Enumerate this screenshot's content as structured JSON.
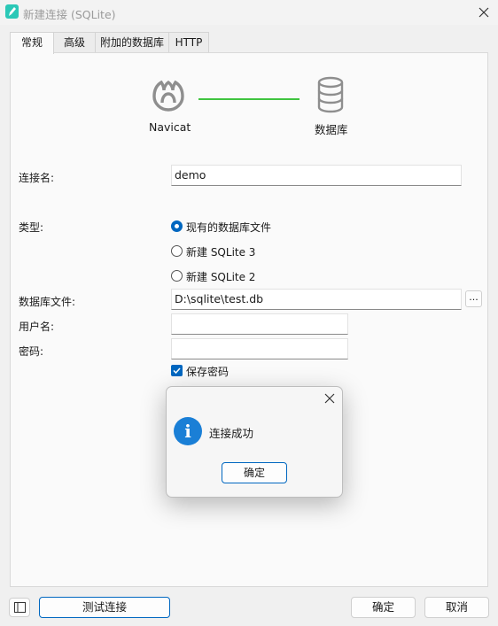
{
  "window": {
    "title": "新建连接 (SQLite)"
  },
  "tabs": [
    {
      "label": "常规",
      "active": true
    },
    {
      "label": "高级",
      "active": false
    },
    {
      "label": "附加的数据库",
      "active": false
    },
    {
      "label": "HTTP",
      "active": false
    }
  ],
  "header_graphic": {
    "left_label": "Navicat",
    "right_label": "数据库",
    "connector_color": "#3fc43f"
  },
  "form": {
    "connection_name": {
      "label": "连接名:",
      "value": "demo"
    },
    "type": {
      "label": "类型:",
      "options": [
        {
          "label": "现有的数据库文件",
          "selected": true
        },
        {
          "label": "新建 SQLite 3",
          "selected": false
        },
        {
          "label": "新建 SQLite 2",
          "selected": false
        }
      ]
    },
    "db_file": {
      "label": "数据库文件:",
      "value": "D:\\sqlite\\test.db",
      "browse_label": "..."
    },
    "username": {
      "label": "用户名:",
      "value": ""
    },
    "password": {
      "label": "密码:",
      "value": ""
    },
    "save_password": {
      "label": "保存密码",
      "checked": true
    }
  },
  "message_box": {
    "text": "连接成功",
    "ok_label": "确定",
    "icon": "info-icon"
  },
  "footer": {
    "test_label": "测试连接",
    "ok_label": "确定",
    "cancel_label": "取消"
  },
  "colors": {
    "accent": "#0067c0",
    "info": "#1a7fd6",
    "app_icon": "#2bc8b7"
  }
}
